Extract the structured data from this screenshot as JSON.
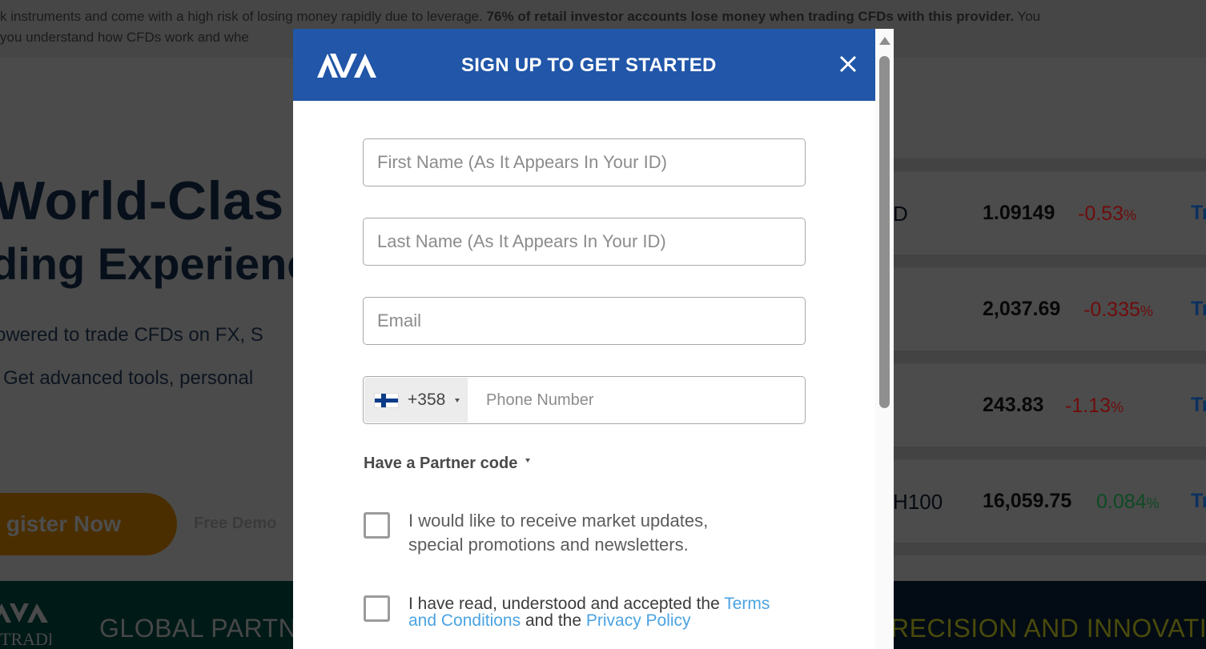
{
  "background": {
    "risk_warning": {
      "line1_start": "k instruments and come with a high risk of losing money rapidly due to leverage. ",
      "line1_bold": "76% of retail investor accounts lose money when trading CFDs with this provider.",
      "line1_end": " You",
      "line2": "you understand how CFDs work and whe"
    },
    "hero": {
      "title_line1": "World-Clas",
      "title_line2": "ding Experienc",
      "subtitle_line1": "owered to trade CFDs on FX, S",
      "subtitle_line2": "Get advanced tools, personal",
      "register_button": "gister Now",
      "demo_link": "Free Demo"
    },
    "tickers": [
      {
        "symbol": "D",
        "price": "1.09149",
        "change": "-0.53",
        "change_unit": "%",
        "direction": "negative",
        "trade_label": "Tr"
      },
      {
        "symbol": "",
        "price": "2,037.69",
        "change": "-0.335",
        "change_unit": "%",
        "direction": "negative",
        "trade_label": "Tr"
      },
      {
        "symbol": "",
        "price": "243.83",
        "change": "-1.13",
        "change_unit": "%",
        "direction": "negative",
        "trade_label": "Tr"
      },
      {
        "symbol": "H100",
        "price": "16,059.75",
        "change": "0.084",
        "change_unit": "%",
        "direction": "positive",
        "trade_label": "Tr"
      }
    ],
    "partners": {
      "logo_text": "TRADE",
      "left_text": "GLOBAL PARTN",
      "right_text": "RECISION AND INNOVATI"
    }
  },
  "modal": {
    "title": "SIGN UP TO GET STARTED",
    "brand_color": "#2156a8",
    "fields": {
      "first_name": {
        "value": "",
        "placeholder": "First Name (As It Appears In Your ID)"
      },
      "last_name": {
        "value": "",
        "placeholder": "Last Name (As It Appears In Your ID)"
      },
      "email": {
        "value": "",
        "placeholder": "Email"
      },
      "phone": {
        "country_flag": "finland-flag",
        "dial_code": "+358",
        "value": "",
        "placeholder": "Phone Number"
      }
    },
    "partner_code_label": "Have a Partner code",
    "marketing_consent": {
      "checked": false,
      "text": "I would like to receive market updates, special promotions and newsletters."
    },
    "terms_consent": {
      "checked": false,
      "text_before": "I have read, understood and accepted the ",
      "terms_link": "Terms and Conditions",
      "text_middle": " and the ",
      "privacy_link": "Privacy Policy"
    },
    "link_color": "#4ba3e2"
  }
}
